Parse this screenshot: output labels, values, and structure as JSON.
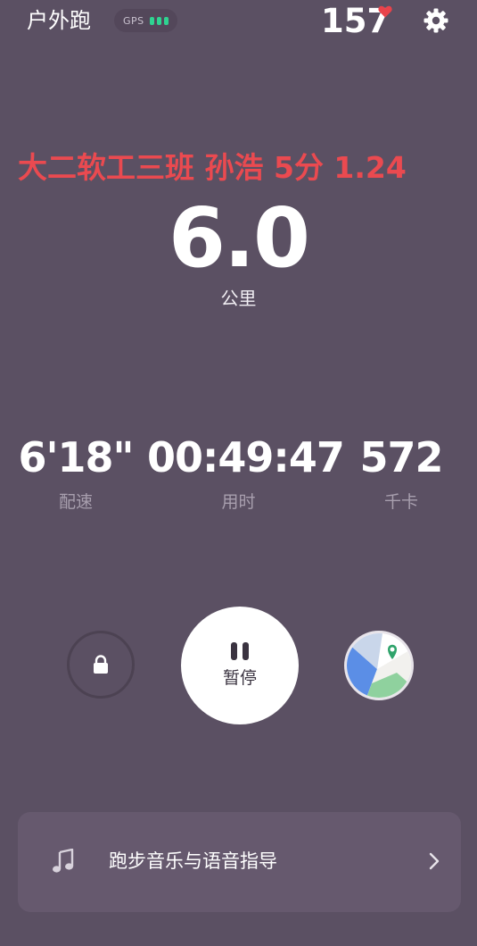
{
  "header": {
    "title": "户外跑",
    "gps_label": "GPS",
    "heart_rate": "157",
    "heart_icon": "heart-icon",
    "settings_icon": "gear-icon"
  },
  "overlay_text": "大二软工三班  孙浩  5分  1.24",
  "distance": {
    "value": "6.0",
    "unit": "公里"
  },
  "stats": {
    "pace": {
      "value": "6'18\"",
      "label": "配速"
    },
    "duration": {
      "value": "00:49:47",
      "label": "用时"
    },
    "calories": {
      "value": "572",
      "label": "千卡"
    }
  },
  "controls": {
    "lock_icon": "lock-icon",
    "pause_label": "暂停",
    "pause_icon": "pause-icon",
    "map_icon": "map-icon"
  },
  "music_card": {
    "label": "跑步音乐与语音指导",
    "icon": "music-note-icon",
    "chevron": "chevron-right-icon"
  },
  "colors": {
    "background": "#5b5063",
    "overlay_red": "#ea4a50",
    "gps_green": "#2fd391",
    "heart_red": "#e8434b",
    "card": "#66596e"
  }
}
